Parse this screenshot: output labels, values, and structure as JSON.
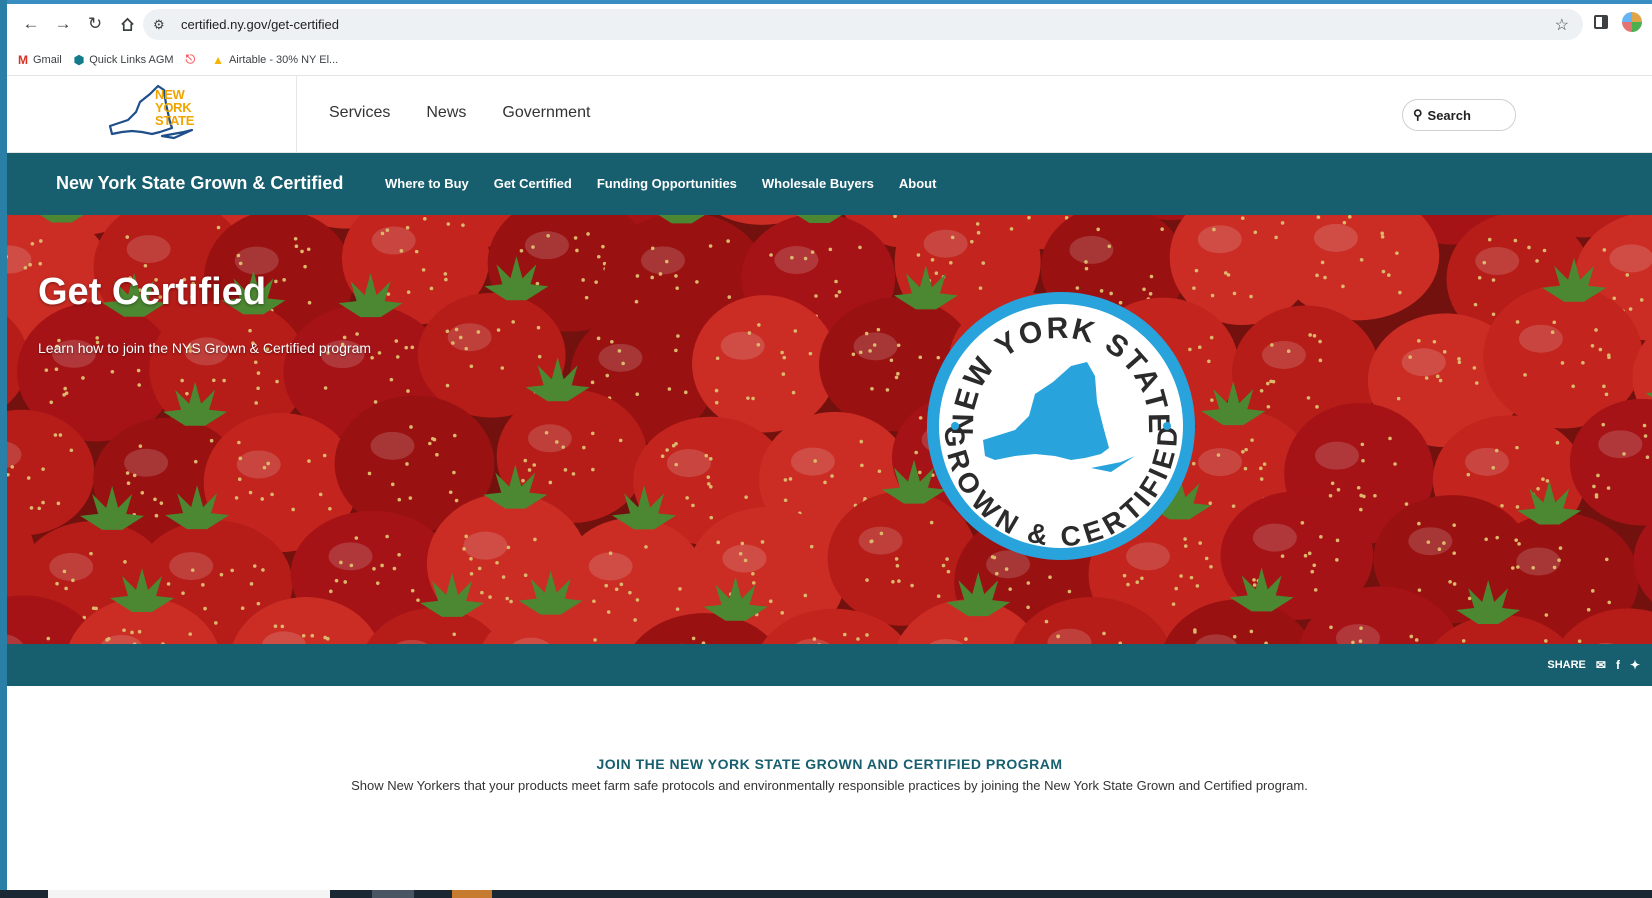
{
  "browser": {
    "url": "certified.ny.gov/get-certified",
    "bookmarks": [
      {
        "label": "Gmail",
        "icon": "gmail-icon"
      },
      {
        "label": "Quick Links AGM",
        "icon": "quick-links-icon"
      },
      {
        "label": "",
        "icon": "airbnb-icon"
      },
      {
        "label": "Airtable - 30% NY El...",
        "icon": "airtable-icon"
      }
    ]
  },
  "ny_header": {
    "logo_lines": [
      "NEW",
      "YORK",
      "STATE"
    ],
    "nav": [
      "Services",
      "News",
      "Government"
    ],
    "search_label": "Search"
  },
  "program_nav": {
    "title": "New York State Grown & Certified",
    "links": [
      "Where to Buy",
      "Get Certified",
      "Funding Opportunities",
      "Wholesale Buyers",
      "About"
    ]
  },
  "hero": {
    "title": "Get Certified",
    "subtitle": "Learn how to join the NYS Grown & Certified program",
    "seal_top_text": "NEW YORK STATE",
    "seal_bottom_text": "GROWN & CERTIFIED"
  },
  "share": {
    "label": "SHARE",
    "icons": [
      "email-icon",
      "facebook-icon",
      "twitter-icon"
    ]
  },
  "content": {
    "heading": "JOIN THE NEW YORK STATE GROWN AND CERTIFIED PROGRAM",
    "body": "Show New Yorkers that your products meet farm safe protocols and environmentally responsible practices by joining the New York State Grown and Certified program."
  },
  "colors": {
    "teal": "#175e6e",
    "seal_blue": "#29a3dc",
    "logo_gold": "#f0a500"
  }
}
